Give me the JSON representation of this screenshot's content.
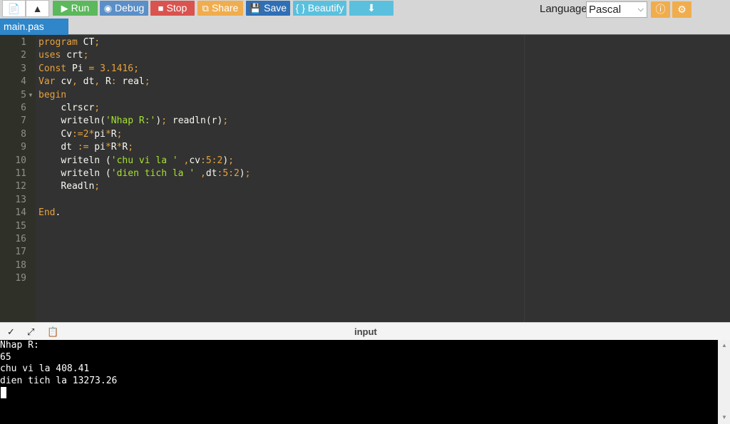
{
  "toolbar": {
    "new_file_icon": "file-icon",
    "upload_icon": "upload-icon",
    "run_label": "Run",
    "debug_label": "Debug",
    "stop_label": "Stop",
    "share_label": "Share",
    "save_label": "Save",
    "beautify_label": "{ } Beautify",
    "download_icon": "download-icon",
    "language_label": "Language",
    "language_value": "Pascal",
    "info_icon": "info-icon",
    "settings_icon": "gear-icon"
  },
  "colors": {
    "run": "#5cb85c",
    "debug": "#5b8fc7",
    "stop": "#d9534f",
    "share": "#f0ad4e",
    "save": "#2f6fb5",
    "beautify": "#5bc0de",
    "download": "#5bc0de"
  },
  "tabs": [
    {
      "label": "main.pas"
    }
  ],
  "editor": {
    "line_numbers": [
      "1",
      "2",
      "3",
      "4",
      "5",
      "6",
      "7",
      "8",
      "9",
      "10",
      "11",
      "12",
      "13",
      "14",
      "15",
      "16",
      "17",
      "18",
      "19"
    ]
  },
  "io": {
    "title": "input",
    "output_lines": [
      "Nhap R:",
      "65",
      "chu vi la 408.41",
      "dien tich la 13273.26"
    ]
  }
}
